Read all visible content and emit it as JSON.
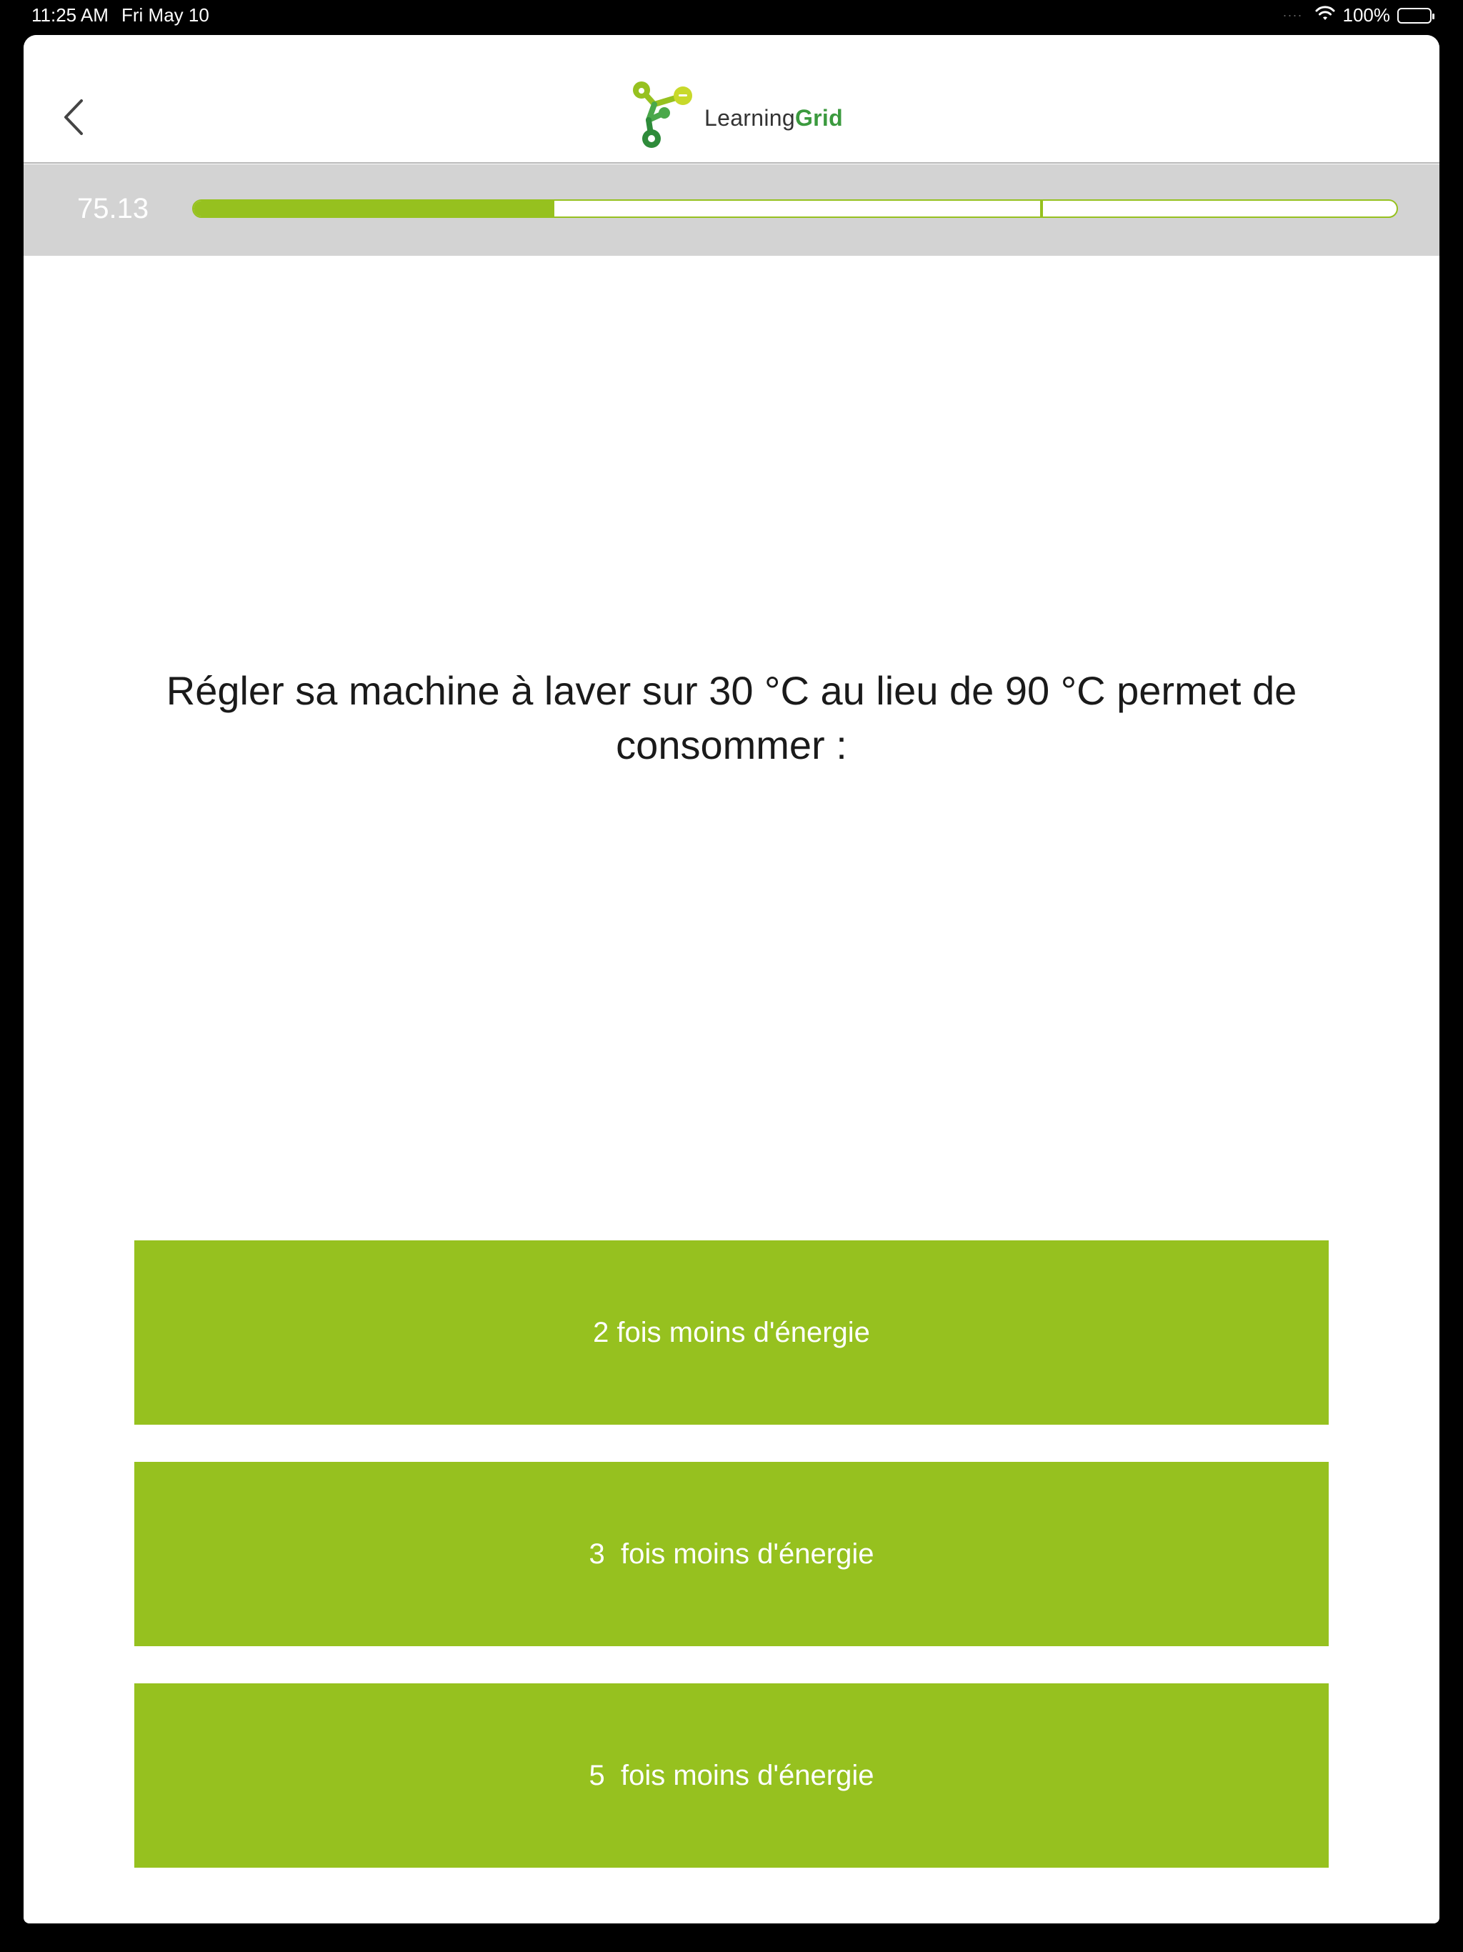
{
  "status_bar": {
    "time": "11:25 AM",
    "date": "Fri May 10",
    "battery": "100%",
    "wifi_icon": "wifi-icon",
    "battery_icon": "battery-icon"
  },
  "header": {
    "back_icon": "chevron-left-icon",
    "logo": {
      "word1": "Learning",
      "word2": "Grid"
    }
  },
  "progress": {
    "score": "75.13",
    "fill_fraction": 0.3,
    "accent_color": "#96c11f"
  },
  "question": {
    "text": "Régler sa machine à laver sur 30 °C au lieu de 90 °C permet de consommer :"
  },
  "answers": [
    {
      "label": "2 fois moins d'énergie"
    },
    {
      "label": "3  fois moins d'énergie"
    },
    {
      "label": "5  fois moins d'énergie"
    }
  ],
  "colors": {
    "accent": "#96c11f",
    "band": "#d3d3d3",
    "logo_green": "#3b9a3e"
  }
}
